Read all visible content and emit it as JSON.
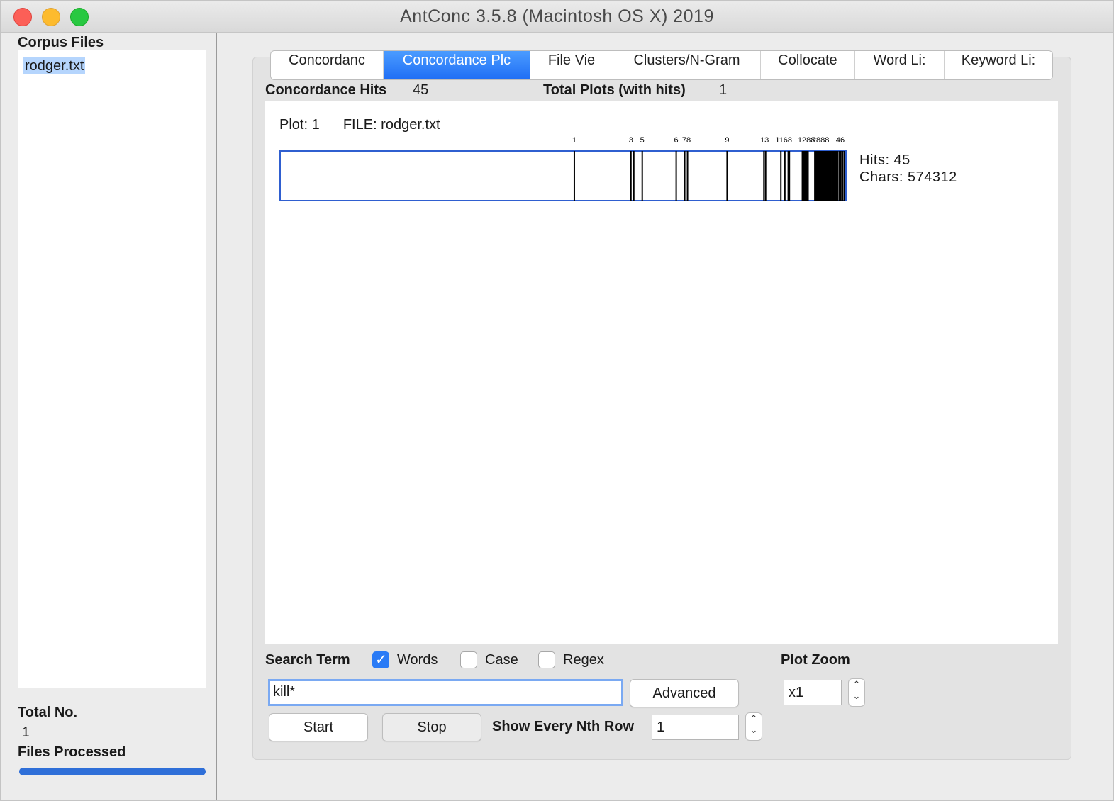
{
  "window": {
    "title": "AntConc 3.5.8 (Macintosh OS X) 2019"
  },
  "left": {
    "corpus_files_label": "Corpus Files",
    "files": [
      "rodger.txt"
    ],
    "total_no_label": "Total No.",
    "total_no_value": "1",
    "files_processed_label": "Files Processed",
    "progress": 1.0
  },
  "tabs": [
    {
      "label": "Concordanc",
      "active": false
    },
    {
      "label": "Concordance Plc",
      "active": true
    },
    {
      "label": "File Vie",
      "active": false
    },
    {
      "label": "Clusters/N-Gram",
      "active": false
    },
    {
      "label": "Collocate",
      "active": false
    },
    {
      "label": "Word Li:",
      "active": false
    },
    {
      "label": "Keyword Li:",
      "active": false
    }
  ],
  "stats": {
    "hits_label": "Concordance Hits",
    "hits_value": "45",
    "plots_label": "Total Plots (with hits)",
    "plots_value": "1"
  },
  "plot": {
    "plot_label": "Plot: 1",
    "file_label": "FILE: rodger.txt",
    "hits_text": "Hits: 45",
    "chars_text": "Chars: 574312",
    "total_chars": 574312,
    "hit_positions": [
      0.52,
      0.62,
      0.625,
      0.64,
      0.7,
      0.715,
      0.72,
      0.79,
      0.855,
      0.858,
      0.885,
      0.892,
      0.898,
      0.9,
      0.923,
      0.925,
      0.927,
      0.929,
      0.931,
      0.933,
      0.945,
      0.947,
      0.949,
      0.951,
      0.953,
      0.955,
      0.957,
      0.959,
      0.961,
      0.963,
      0.965,
      0.967,
      0.969,
      0.971,
      0.973,
      0.975,
      0.977,
      0.979,
      0.981,
      0.983,
      0.985,
      0.988,
      0.991,
      0.994,
      0.997
    ],
    "tick_labels": [
      {
        "label": "1",
        "pos": 0.52
      },
      {
        "label": "3",
        "pos": 0.62
      },
      {
        "label": "5",
        "pos": 0.64
      },
      {
        "label": "6",
        "pos": 0.7
      },
      {
        "label": "78",
        "pos": 0.718
      },
      {
        "label": "9",
        "pos": 0.79
      },
      {
        "label": "13",
        "pos": 0.856
      },
      {
        "label": "1168",
        "pos": 0.89
      },
      {
        "label": "1288",
        "pos": 0.93
      },
      {
        "label": "2888",
        "pos": 0.955
      },
      {
        "label": "46",
        "pos": 0.99
      }
    ],
    "bar_color": "#000000",
    "frame_color": "#2f5fd0"
  },
  "search": {
    "search_term_label": "Search Term",
    "words_label": "Words",
    "words_checked": true,
    "case_label": "Case",
    "case_checked": false,
    "regex_label": "Regex",
    "regex_checked": false,
    "term_value": "kill*",
    "advanced_label": "Advanced",
    "start_label": "Start",
    "stop_label": "Stop",
    "nth_row_label": "Show Every Nth Row",
    "nth_row_value": "1",
    "plot_zoom_label": "Plot Zoom",
    "zoom_value": "x1"
  }
}
